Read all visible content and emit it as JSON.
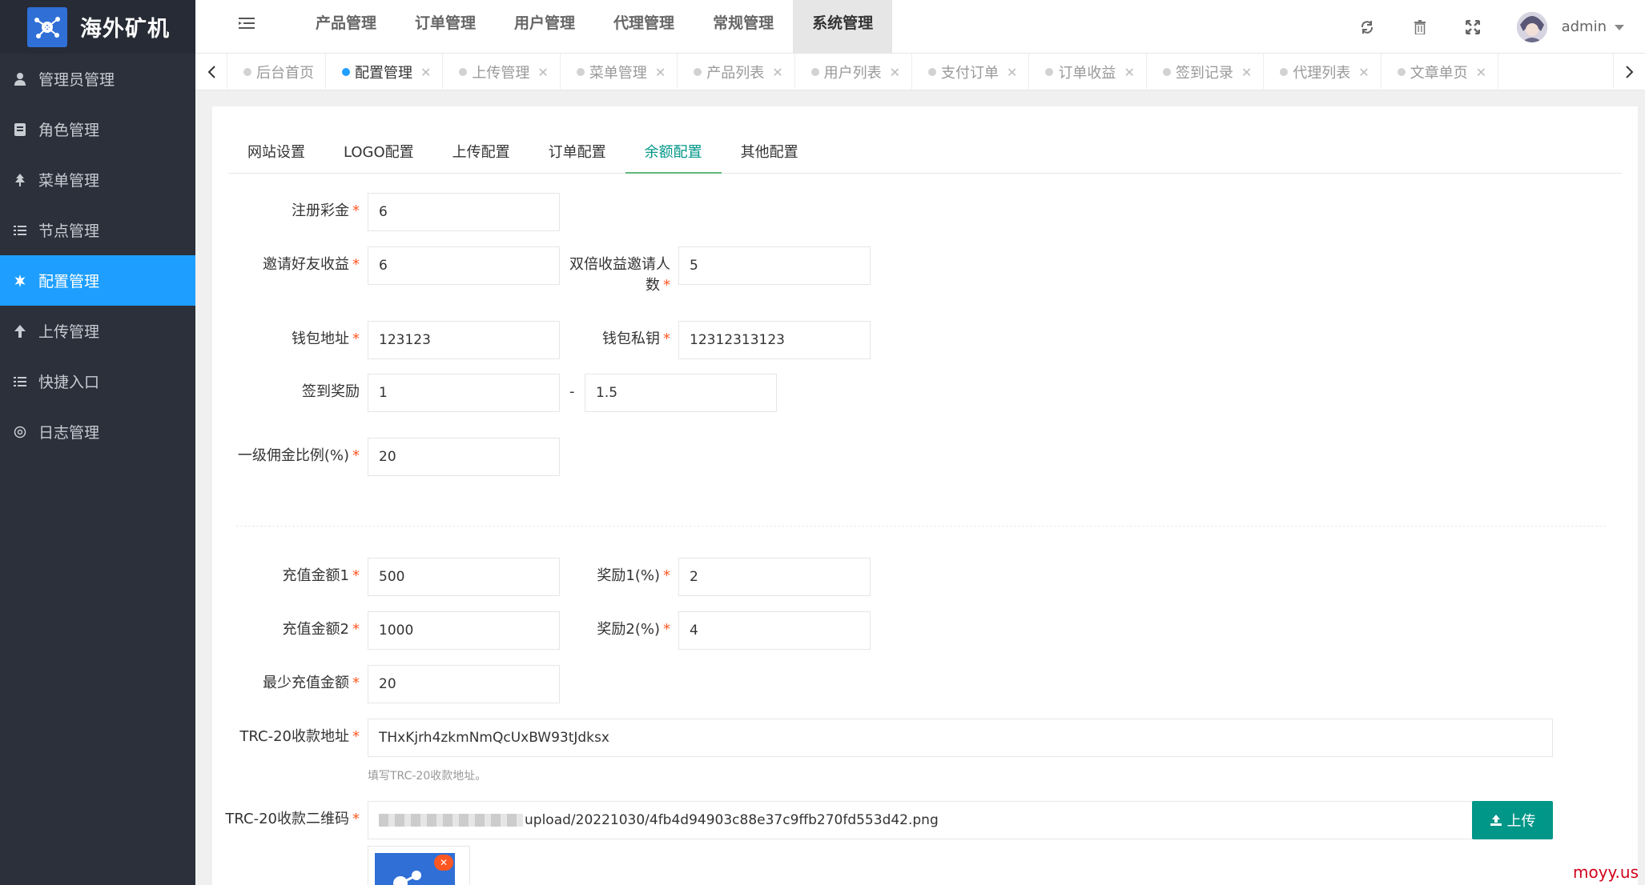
{
  "app": {
    "logo_text": "海外矿机"
  },
  "sidebar": {
    "items": [
      {
        "label": "管理员管理",
        "icon": "user-icon"
      },
      {
        "label": "角色管理",
        "icon": "role-icon"
      },
      {
        "label": "菜单管理",
        "icon": "tree-icon"
      },
      {
        "label": "节点管理",
        "icon": "list-icon"
      },
      {
        "label": "配置管理",
        "icon": "gear-icon",
        "active": true
      },
      {
        "label": "上传管理",
        "icon": "upload-arrow-icon"
      },
      {
        "label": "快捷入口",
        "icon": "list-icon"
      },
      {
        "label": "日志管理",
        "icon": "log-icon"
      }
    ]
  },
  "top_nav": {
    "items": [
      "产品管理",
      "订单管理",
      "用户管理",
      "代理管理",
      "常规管理",
      "系统管理"
    ],
    "active": "系统管理"
  },
  "user": {
    "name": "admin"
  },
  "tabs": {
    "items": [
      "后台首页",
      "配置管理",
      "上传管理",
      "菜单管理",
      "产品列表",
      "用户列表",
      "支付订单",
      "订单收益",
      "签到记录",
      "代理列表",
      "文章单页"
    ],
    "active": "配置管理"
  },
  "sub_tabs": {
    "items": [
      "网站设置",
      "LOGO配置",
      "上传配置",
      "订单配置",
      "余额配置",
      "其他配置"
    ],
    "active": "余额配置"
  },
  "form": {
    "register_bonus": {
      "label": "注册彩金",
      "value": "6"
    },
    "invite_income": {
      "label": "邀请好友收益",
      "value": "6"
    },
    "double_invite": {
      "label": "双倍收益邀请人数",
      "value": "5"
    },
    "wallet_address": {
      "label": "钱包地址",
      "value": "123123"
    },
    "wallet_key": {
      "label": "钱包私钥",
      "value": "12312313123"
    },
    "signin_reward": {
      "label": "签到奖励",
      "value_min": "1",
      "value_max": "1.5",
      "separator": "-"
    },
    "commission": {
      "label": "一级佣金比例(%)",
      "value": "20"
    },
    "recharge1": {
      "label": "充值金额1",
      "value": "500"
    },
    "reward1": {
      "label": "奖励1(%)",
      "value": "2"
    },
    "recharge2": {
      "label": "充值金额2",
      "value": "1000"
    },
    "reward2": {
      "label": "奖励2(%)",
      "value": "4"
    },
    "min_recharge": {
      "label": "最少充值金额",
      "value": "20"
    },
    "trc20_address": {
      "label": "TRC-20收款地址",
      "value": "THxKjrh4zkmNmQcUxBW93tJdksx",
      "hint": "填写TRC-20收款地址。"
    },
    "trc20_qr": {
      "label": "TRC-20收款二维码",
      "value_suffix": "upload/20221030/4fb4d94903c88e37c9ffb270fd553d42.png",
      "upload_label": "上传"
    }
  },
  "watermark": "moyy.us",
  "colors": {
    "sidebar_bg": "#2b303b",
    "sidebar_active": "#1e9fff",
    "primary": "#009688",
    "required": "#ff5722"
  }
}
